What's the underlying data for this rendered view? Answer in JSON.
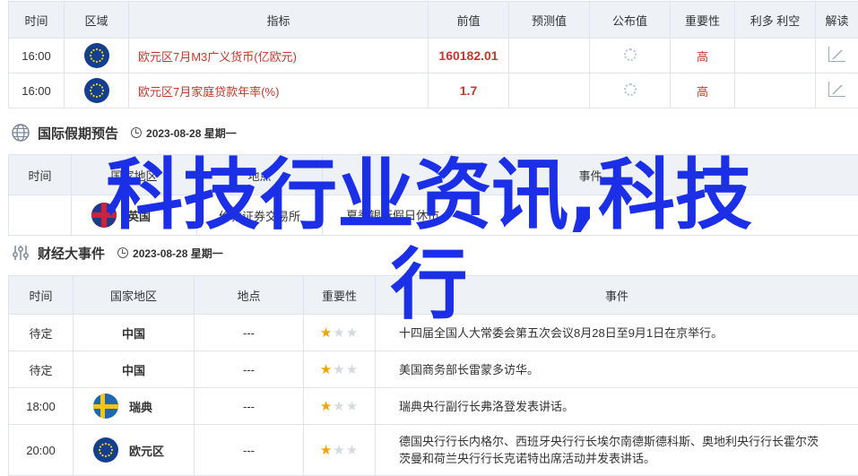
{
  "top_table": {
    "headers": [
      "时间",
      "区域",
      "指标",
      "前值",
      "预测值",
      "公布值",
      "重要性",
      "利多 利空",
      "解读"
    ],
    "rows": [
      {
        "time": "16:00",
        "region_flag": "eu-flag",
        "indicator": "欧元区7月M3广义货币(亿欧元)",
        "previous": "160182.01",
        "forecast": "",
        "actual_icon": "loading-spinner",
        "importance": "高",
        "bull_bear": "",
        "analysis_icon": "chart-icon"
      },
      {
        "time": "16:00",
        "region_flag": "eu-flag",
        "indicator": "欧元区7月家庭贷款年率(%)",
        "previous": "1.7",
        "forecast": "",
        "actual_icon": "loading-spinner",
        "importance": "高",
        "bull_bear": "",
        "analysis_icon": "chart-icon"
      }
    ]
  },
  "holiday_section": {
    "title": "国际假期预告",
    "date": "2023-08-28 星期一",
    "headers": [
      "时间",
      "国家地区",
      "地点",
      "事件"
    ],
    "rows": [
      {
        "time": "",
        "country": "英国",
        "place": "伦敦证券交易所",
        "event": "夏季银行假日休市"
      }
    ]
  },
  "events_section": {
    "title": "财经大事件",
    "date": "2023-08-28 星期一",
    "headers": [
      "时间",
      "国家地区",
      "地点",
      "重要性",
      "事件"
    ],
    "rows": [
      {
        "time": "待定",
        "flag": "",
        "country": "中国",
        "place": "---",
        "stars": 1,
        "event": "十四届全国人大常委会第五次会议8月28日至9月1日在京举行。"
      },
      {
        "time": "待定",
        "flag": "",
        "country": "中国",
        "place": "---",
        "stars": 1,
        "event": "美国商务部长雷蒙多访华。"
      },
      {
        "time": "18:00",
        "flag": "se-flag",
        "country": "瑞典",
        "place": "---",
        "stars": 1,
        "event": "瑞典央行副行长弗洛登发表讲话。"
      },
      {
        "time": "20:00",
        "flag": "eu-flag",
        "country": "欧元区",
        "place": "---",
        "stars": 1,
        "event_line1": "德国央行行长内格尔、西班牙央行行长埃尔南德斯德科斯、奥地利央行行长霍尔茨",
        "event_line2": "茨曼和荷兰央行行长克诺特出席活动并发表讲话。"
      }
    ]
  },
  "overlay_text": {
    "line1": "科技行业资讯,科技",
    "line2": "行"
  },
  "colors": {
    "accent_red": "#c0392b",
    "header_bg": "#eef1f6",
    "overlay_blue": "#1a2fe6",
    "star_on": "#f0a500"
  }
}
